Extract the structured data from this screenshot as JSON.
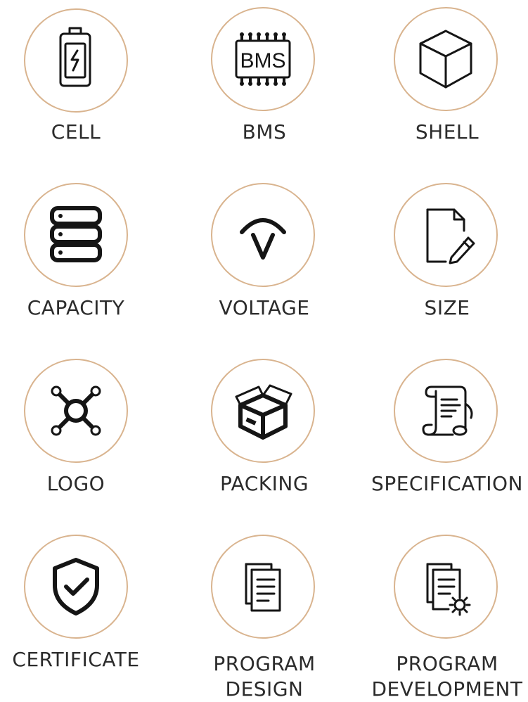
{
  "items": [
    {
      "label": "CELL",
      "icon": "battery-icon"
    },
    {
      "label": "BMS",
      "icon": "bms-chip-icon",
      "chip_text": "BMS"
    },
    {
      "label": "SHELL",
      "icon": "cube-icon"
    },
    {
      "label": "CAPACITY",
      "icon": "server-stack-icon"
    },
    {
      "label": "VOLTAGE",
      "icon": "voltage-icon"
    },
    {
      "label": "SIZE",
      "icon": "document-edit-icon"
    },
    {
      "label": "LOGO",
      "icon": "network-nodes-icon"
    },
    {
      "label": "PACKING",
      "icon": "open-box-icon"
    },
    {
      "label": "SPECIFICATION",
      "icon": "scroll-music-icon"
    },
    {
      "label": "CERTIFICATE",
      "icon": "shield-check-icon"
    },
    {
      "label": "PROGRAM",
      "label2": "DESIGN",
      "icon": "documents-icon"
    },
    {
      "label": "PROGRAM",
      "label2": "DEVELOPMENT",
      "icon": "documents-gear-icon"
    }
  ],
  "colors": {
    "circle_border": "#d9b48f",
    "icon": "#151515",
    "text": "#2b2b2b"
  }
}
